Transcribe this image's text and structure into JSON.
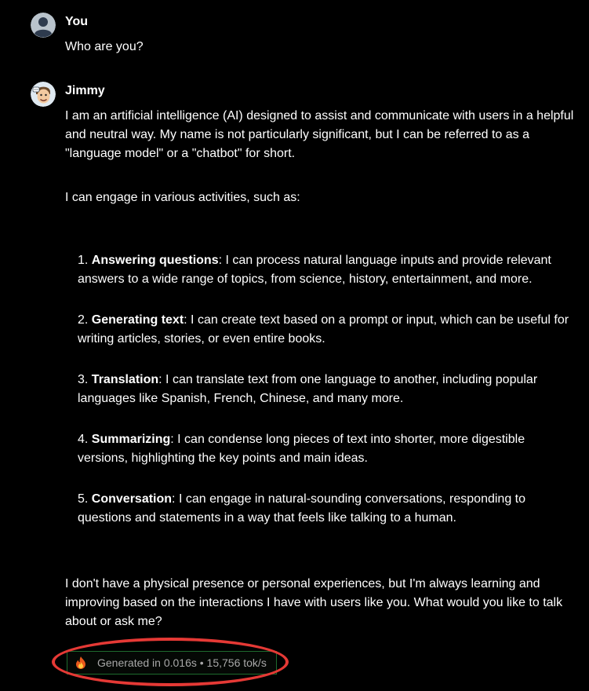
{
  "messages": {
    "user": {
      "author": "You",
      "text": "Who are you?"
    },
    "assistant": {
      "author": "Jimmy",
      "intro": "I am an artificial intelligence (AI) designed to assist and communicate with users in a helpful and neutral way. My name is not particularly significant, but I can be referred to as a \"language model\" or a \"chatbot\" for short.",
      "activities_lead": "I can engage in various activities, such as:",
      "items": [
        {
          "num": "1. ",
          "title": "Answering questions",
          "body": ": I can process natural language inputs and provide relevant answers to a wide range of topics, from science, history, entertainment, and more."
        },
        {
          "num": "2. ",
          "title": "Generating text",
          "body": ": I can create text based on a prompt or input, which can be useful for writing articles, stories, or even entire books."
        },
        {
          "num": "3. ",
          "title": "Translation",
          "body": ": I can translate text from one language to another, including popular languages like Spanish, French, Chinese, and many more."
        },
        {
          "num": "4. ",
          "title": "Summarizing",
          "body": ": I can condense long pieces of text into shorter, more digestible versions, highlighting the key points and main ideas."
        },
        {
          "num": "5. ",
          "title": "Conversation",
          "body": ": I can engage in natural-sounding conversations, responding to questions and statements in a way that feels like talking to a human."
        }
      ],
      "closing": "I don't have a physical presence or personal experiences, but I'm always learning and improving based on the interactions I have with users like you. What would you like to talk about or ask me?",
      "stats": "Generated in 0.016s • 15,756 tok/s"
    }
  },
  "colors": {
    "background": "#000000",
    "text": "#ffffff",
    "stats_text": "#a8a8a8",
    "stats_border": "#1e6b2e",
    "annotation_ring": "#e53935"
  },
  "icons": {
    "user_avatar": "user-silhouette-icon",
    "assistant_avatar": "cartoon-face-avatar",
    "stats": "flame-icon"
  }
}
